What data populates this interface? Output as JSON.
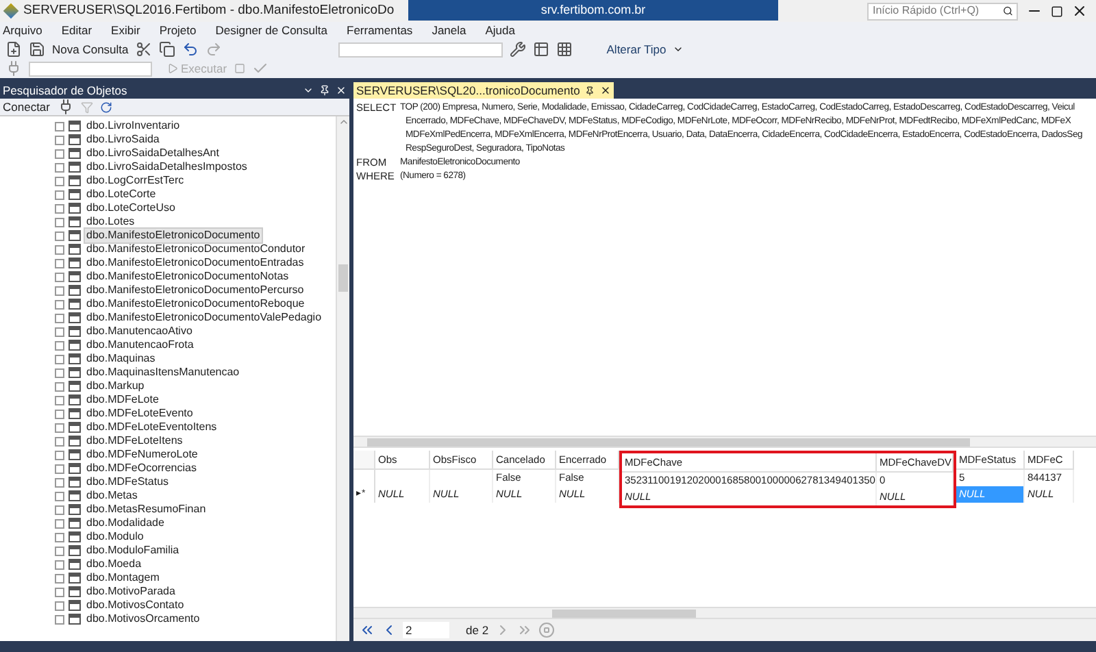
{
  "window": {
    "title": "SERVERUSER\\SQL2016.Fertibom - dbo.ManifestoEletronicoDo",
    "remote_bar": "srv.fertibom.com.br",
    "quick_launch": {
      "placeholder": "Início Rápido (Ctrl+Q)"
    }
  },
  "menu": [
    "Arquivo",
    "Editar",
    "Exibir",
    "Projeto",
    "Designer de Consulta",
    "Ferramentas",
    "Janela",
    "Ajuda"
  ],
  "toolbar": {
    "new_query": "Nova Consulta",
    "change_type": "Alterar Tipo",
    "execute": {
      "label": "Executar",
      "disabled": true
    }
  },
  "object_explorer": {
    "title": "Pesquisador de Objetos",
    "connect": "Conectar",
    "items": [
      {
        "label": "dbo.LivroInventario",
        "selected": false
      },
      {
        "label": "dbo.LivroSaida",
        "selected": false
      },
      {
        "label": "dbo.LivroSaidaDetalhesAnt",
        "selected": false
      },
      {
        "label": "dbo.LivroSaidaDetalhesImpostos",
        "selected": false
      },
      {
        "label": "dbo.LogCorrEstTerc",
        "selected": false
      },
      {
        "label": "dbo.LoteCorte",
        "selected": false
      },
      {
        "label": "dbo.LoteCorteUso",
        "selected": false
      },
      {
        "label": "dbo.Lotes",
        "selected": false
      },
      {
        "label": "dbo.ManifestoEletronicoDocumento",
        "selected": true
      },
      {
        "label": "dbo.ManifestoEletronicoDocumentoCondutor",
        "selected": false
      },
      {
        "label": "dbo.ManifestoEletronicoDocumentoEntradas",
        "selected": false
      },
      {
        "label": "dbo.ManifestoEletronicoDocumentoNotas",
        "selected": false
      },
      {
        "label": "dbo.ManifestoEletronicoDocumentoPercurso",
        "selected": false
      },
      {
        "label": "dbo.ManifestoEletronicoDocumentoReboque",
        "selected": false
      },
      {
        "label": "dbo.ManifestoEletronicoDocumentoValePedagio",
        "selected": false
      },
      {
        "label": "dbo.ManutencaoAtivo",
        "selected": false
      },
      {
        "label": "dbo.ManutencaoFrota",
        "selected": false
      },
      {
        "label": "dbo.Maquinas",
        "selected": false
      },
      {
        "label": "dbo.MaquinasItensManutencao",
        "selected": false
      },
      {
        "label": "dbo.Markup",
        "selected": false
      },
      {
        "label": "dbo.MDFeLote",
        "selected": false
      },
      {
        "label": "dbo.MDFeLoteEvento",
        "selected": false
      },
      {
        "label": "dbo.MDFeLoteEventoItens",
        "selected": false
      },
      {
        "label": "dbo.MDFeLoteItens",
        "selected": false
      },
      {
        "label": "dbo.MDFeNumeroLote",
        "selected": false
      },
      {
        "label": "dbo.MDFeOcorrencias",
        "selected": false
      },
      {
        "label": "dbo.MDFeStatus",
        "selected": false
      },
      {
        "label": "dbo.Metas",
        "selected": false
      },
      {
        "label": "dbo.MetasResumoFinan",
        "selected": false
      },
      {
        "label": "dbo.Modalidade",
        "selected": false
      },
      {
        "label": "dbo.Modulo",
        "selected": false
      },
      {
        "label": "dbo.ModuloFamilia",
        "selected": false
      },
      {
        "label": "dbo.Moeda",
        "selected": false
      },
      {
        "label": "dbo.Montagem",
        "selected": false
      },
      {
        "label": "dbo.MotivoParada",
        "selected": false
      },
      {
        "label": "dbo.MotivosContato",
        "selected": false
      },
      {
        "label": "dbo.MotivosOrcamento",
        "selected": false
      }
    ]
  },
  "editor": {
    "tab": "SERVERUSER\\SQL20...tronicoDocumento",
    "sql": [
      {
        "keyword": "SELECT",
        "lines": [
          "TOP (200) Empresa, Numero, Serie, Modalidade, Emissao, CidadeCarreg, CodCidadeCarreg, EstadoCarreg, CodEstadoCarreg, EstadoDescarreg, CodEstadoDescarreg, Veicul",
          "Encerrado, MDFeChave, MDFeChaveDV, MDFeStatus, MDFeCodigo, MDFeNrLote, MDFeOcorr, MDFeNrRecibo, MDFeNrProt, MDFedtRecibo, MDFeXmlPedCanc, MDFeX",
          "MDFeXmlPedEncerra, MDFeXmlEncerra, MDFeNrProtEncerra, Usuario, Data, DataEncerra, CidadeEncerra, CodCidadeEncerra, EstadoEncerra, CodEstadoEncerra, DadosSeg",
          "RespSeguroDest, Seguradora, TipoNotas"
        ]
      },
      {
        "keyword": "FROM",
        "lines": [
          "ManifestoEletronicoDocumento"
        ]
      },
      {
        "keyword": "WHERE",
        "lines": [
          "(Numero = 6278)"
        ]
      }
    ]
  },
  "grid": {
    "columns": [
      {
        "header": "Obs",
        "highlighted": false,
        "cells": [
          {
            "selected": false
          },
          {
            "value": "NULL",
            "selected": false
          }
        ]
      },
      {
        "header": "ObsFisco",
        "highlighted": false,
        "cells": [
          {
            "selected": false
          },
          {
            "value": "NULL",
            "selected": false
          }
        ]
      },
      {
        "header": "Cancelado",
        "highlighted": false,
        "cells": [
          {
            "value": "False",
            "selected": false
          },
          {
            "value": "NULL",
            "selected": false
          }
        ]
      },
      {
        "header": "Encerrado",
        "highlighted": false,
        "cells": [
          {
            "value": "False",
            "selected": false
          },
          {
            "value": "NULL",
            "selected": false
          }
        ]
      },
      {
        "header": "MDFeChave",
        "highlighted": true,
        "cells": [
          {
            "value": "35231100191202000168580010000062781349401350",
            "selected": false
          },
          {
            "value": "NULL",
            "selected": false
          }
        ]
      },
      {
        "header": "MDFeChaveDV",
        "highlighted": true,
        "cells": [
          {
            "value": "0",
            "selected": false
          },
          {
            "value": "NULL",
            "selected": false
          }
        ]
      },
      {
        "header": "MDFeStatus",
        "highlighted": false,
        "cells": [
          {
            "value": "5",
            "selected": false
          },
          {
            "value": "NULL",
            "selected": true
          }
        ]
      },
      {
        "header": "MDFeC",
        "highlighted": false,
        "cells": [
          {
            "value": "844137",
            "selected": false
          },
          {
            "value": "NULL",
            "selected": false
          }
        ]
      }
    ],
    "new_row_marker": "▸*",
    "pager": {
      "page": "2",
      "of": "de 2"
    }
  }
}
